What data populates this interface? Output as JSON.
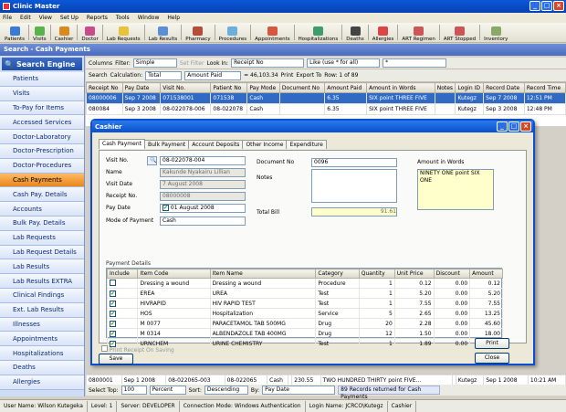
{
  "app": {
    "title": "Clinic Master"
  },
  "menu": [
    "File",
    "Edit",
    "View",
    "Set Up",
    "Reports",
    "Tools",
    "Window",
    "Help"
  ],
  "toolbar": [
    "Patients",
    "Visits",
    "Cashier",
    "Doctor",
    "Lab Requests",
    "Lab Results",
    "Pharmacy",
    "Procedures",
    "Appointments",
    "Hospitalizations",
    "Deaths",
    "Allergies",
    "ART Regimen",
    "ART Stopped",
    "Inventory"
  ],
  "window_title": "Search - Cash Payments",
  "sidebar": {
    "header": "Search Engine",
    "items": [
      "Patients",
      "Visits",
      "To-Pay for Items",
      "Accessed Services",
      "Doctor-Laboratory",
      "Doctor-Prescription",
      "Doctor-Procedures",
      "Cash Payments",
      "Cash Pay. Details",
      "Accounts",
      "Bulk Pay. Details",
      "Lab Requests",
      "Lab Request Details",
      "Lab Results",
      "Lab Results EXTRA",
      "Clinical Findings",
      "Ext. Lab Results",
      "Illnesses",
      "Appointments",
      "Hospitalizations",
      "Deaths",
      "Allergies"
    ],
    "active_index": 7
  },
  "filter": {
    "columns": "Columns",
    "filter_label": "Filter:",
    "filter_value": "Simple",
    "set_filter": "Set Filter",
    "look_in": "Look In:",
    "look_in_value": "Receipt No",
    "like": "Like (use * for all)",
    "like_value": "*"
  },
  "calc": {
    "search": "Search",
    "calc_label": "Calculation:",
    "calc_value": "Total",
    "field_value": "Amount Paid",
    "equals": "= 46,103.34",
    "print": "Print",
    "export": "Export To",
    "rows": "Row: 1 of 89"
  },
  "grid": {
    "columns": [
      "Receipt No",
      "Pay Date",
      "Visit No.",
      "Patient No",
      "Pay Mode",
      "Document No",
      "Amount Paid",
      "Amount in Words",
      "Notes",
      "Login ID",
      "Record Date",
      "Record Time"
    ],
    "rows": [
      [
        "08000006",
        "Sep 7 2008",
        "071538001",
        "071538",
        "Cash",
        "",
        "6.35",
        "SIX point THREE FIVE",
        "",
        "Kutegz",
        "Sep 7 2008",
        "12:51 PM"
      ],
      [
        "080084",
        "Sep 3 2008",
        "08-022078-006",
        "08-022078",
        "Cash",
        "",
        "6.35",
        "SIX point THREE FIVE",
        "",
        "Kutegz",
        "Sep 3 2008",
        "12:48 PM"
      ]
    ]
  },
  "bottom_row": [
    "0800001",
    "Sep 1 2008",
    "08-022065-003",
    "08-022065",
    "Cash",
    "",
    "230.55",
    "TWO HUNDRED THIRTY point FIVE...",
    "",
    "Kutegz",
    "Sep 1 2008",
    "10:21 AM"
  ],
  "footer": {
    "select_top": "Select Top:",
    "top_value": "100",
    "percent": "Percent",
    "sort": "Sort:",
    "sort_value": "Descending",
    "by": "By:",
    "by_value": "Pay Date",
    "records": "89 Records returned for Cash Payments"
  },
  "status": [
    "User Name: Wilson Kutegeka",
    "Level: 1",
    "Server: DEVELOPER",
    "Connection Mode: Windows Authentication",
    "Login Name: JCRCO\\Kutegz",
    "Cashier"
  ],
  "dialog": {
    "title": "Cashier",
    "tabs": [
      "Cash Payment",
      "Bulk Payment",
      "Account Deposits",
      "Other Income",
      "Expenditure"
    ],
    "labels": {
      "visit_no": "Visit No.",
      "name": "Name",
      "visit_date": "Visit Date",
      "receipt_no": "Receipt No.",
      "pay_date": "Pay Date",
      "mode": "Mode of Payment",
      "document_no": "Document No",
      "notes": "Notes",
      "total_bill": "Total Bill",
      "amount_words": "Amount in Words",
      "payment_details": "Payment Details",
      "print_receipt": "Print Receipt On Saving"
    },
    "values": {
      "visit_no": "08-022078-004",
      "name": "Kakunde Nyakairu Lillian",
      "visit_date": "7 August 2008",
      "receipt_no": "08000008",
      "pay_day": "01",
      "pay_month": "August",
      "pay_year": "2008",
      "mode": "Cash",
      "document_no": "0096",
      "total_bill": "91.61",
      "amount_words": "NINETY ONE point SIX ONE"
    },
    "columns": [
      "Include",
      "Item Code",
      "Item Name",
      "Category",
      "Quantity",
      "Unit Price",
      "Discount",
      "Amount"
    ],
    "items": [
      [
        "",
        "Dressing a wound",
        "Dressing a wound",
        "Procedure",
        "1",
        "0.12",
        "0.00",
        "0.12"
      ],
      [
        "✔",
        "EREA",
        "UREA",
        "Test",
        "1",
        "5.20",
        "0.00",
        "5.20"
      ],
      [
        "✔",
        "HIVRAPID",
        "HIV RAPID TEST",
        "Test",
        "1",
        "7.55",
        "0.00",
        "7.55"
      ],
      [
        "✔",
        "HOS",
        "Hospitalization",
        "Service",
        "5",
        "2.65",
        "0.00",
        "13.25"
      ],
      [
        "✔",
        "M 0077",
        "PARACETAMOL TAB 500MG",
        "Drug",
        "20",
        "2.28",
        "0.00",
        "45.60"
      ],
      [
        "✔",
        "M 0314",
        "ALBENDAZOLE TAB 400MG",
        "Drug",
        "12",
        "1.50",
        "0.00",
        "18.00"
      ],
      [
        "✔",
        "URNCHEM",
        "URINE CHEMISTRY",
        "Test",
        "1",
        "1.89",
        "0.00",
        "1.89"
      ]
    ],
    "buttons": {
      "save": "Save",
      "print": "Print",
      "close": "Close"
    }
  }
}
